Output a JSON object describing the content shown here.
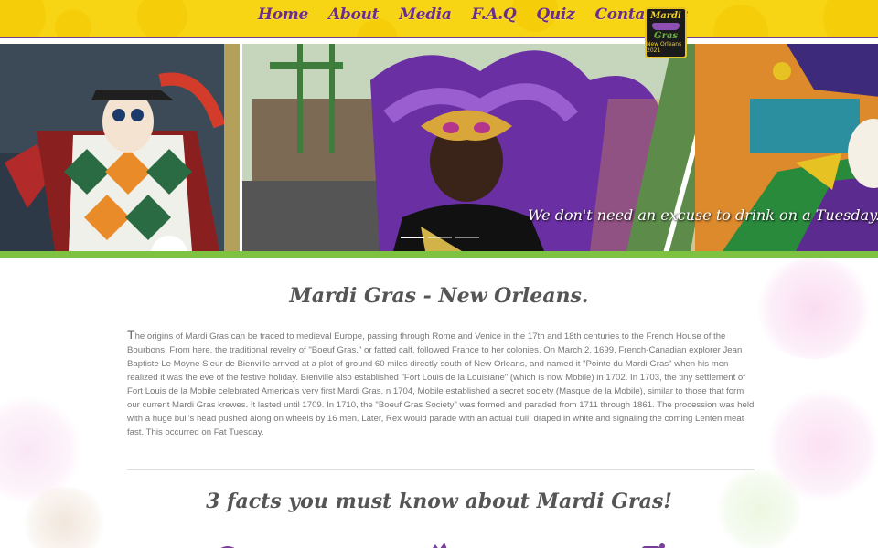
{
  "nav": {
    "items": [
      "Home",
      "About",
      "Media",
      "F.A.Q",
      "Quiz",
      "Contact Us"
    ],
    "logo": {
      "line1": "Mardi",
      "line2": "Gras",
      "line3": "New Orleans 2021"
    }
  },
  "hero": {
    "caption": "We don't need an excuse to drink on a Tuesday."
  },
  "main": {
    "title": "Mardi Gras - New Orleans.",
    "history_first_letter": "T",
    "history_text": "he origins of Mardi Gras can be traced to medieval Europe, passing through Rome and Venice in the 17th and 18th centuries to the French House of the Bourbons. From here, the traditional revelry of \"Boeuf Gras,\" or fatted calf, followed France to her colonies. On March 2, 1699, French-Canadian explorer Jean Baptiste Le Moyne Sieur de Bienville arrived at a plot of ground 60 miles directly south of New Orleans, and named it \"Pointe du Mardi Gras\" when his men realized it was the eve of the festive holiday. Bienville also established \"Fort Louis de la Louisiane\" (which is now Mobile) in 1702. In 1703, the tiny settlement of Fort Louis de la Mobile celebrated America's very first Mardi Gras. n 1704, Mobile established a secret society (Masque de la Mobile), similar to those that form our current Mardi Gras krewes. It lasted until 1709. In 1710, the \"Boeuf Gras Society\" was formed and paraded from 1711 through 1861. The procession was held with a huge bull's head pushed along on wheels by 16 men. Later, Rex would parade with an actual bull, draped in white and signaling the coming Lenten meat fast. This occurred on Fat Tuesday.",
    "facts_title": "3 facts you must know about Mardi Gras!"
  },
  "colors": {
    "nav_yellow": "#f7d515",
    "nav_purple": "#6b2d8c",
    "accent_green": "#7dc241"
  }
}
